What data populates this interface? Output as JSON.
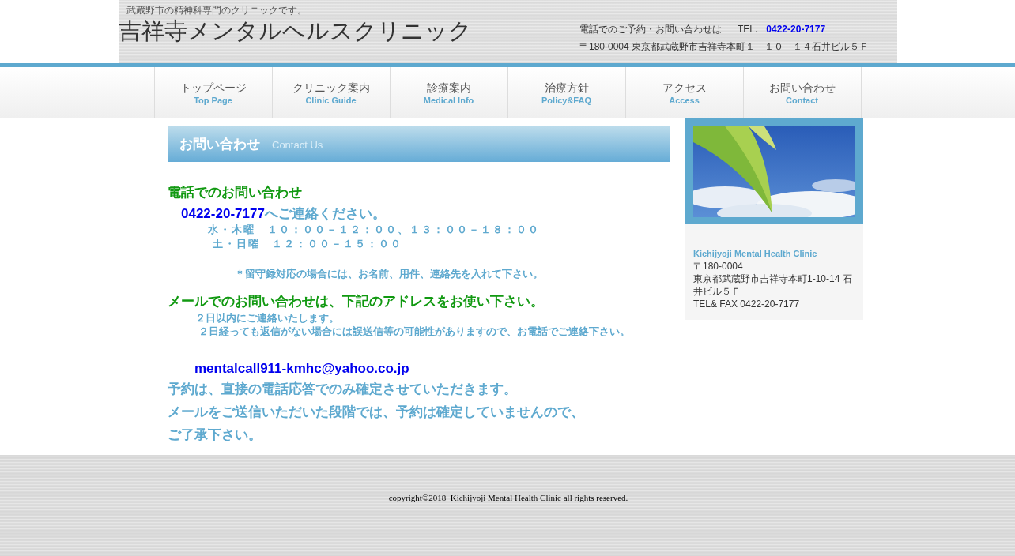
{
  "header": {
    "tagline": "武蔵野市の精神科専門のクリニックです。",
    "site_title": "吉祥寺メンタルヘルスクリニック",
    "contact_label": "電話でのご予約・お問い合わせは",
    "tel_label": "TEL.",
    "tel": "0422-20-7177",
    "address": "〒180-0004 東京都武蔵野市吉祥寺本町１－１０－１４石井ビル５Ｆ"
  },
  "nav": [
    {
      "label": "トップページ",
      "sub": "Top Page"
    },
    {
      "label": "クリニック案内",
      "sub": "Clinic Guide"
    },
    {
      "label": "診療案内",
      "sub": "Medical Info"
    },
    {
      "label": "治療方針",
      "sub": "Policy&FAQ"
    },
    {
      "label": "アクセス",
      "sub": "Access"
    },
    {
      "label": "お問い合わせ",
      "sub": "Contact"
    }
  ],
  "page_heading": {
    "title": "お問い合わせ",
    "subtitle": "Contact Us"
  },
  "content": [
    {
      "kind": "heading",
      "text": "電話でのお問い合わせ"
    },
    {
      "kind": "phone",
      "number": "0422-20-7177",
      "text": "へご連絡ください。"
    },
    {
      "kind": "hours",
      "text": "水・木曜　１０：００－１２：００、１３：００－１８：００"
    },
    {
      "kind": "hours",
      "text": " 土・日曜　１２：００－１５：００"
    },
    {
      "kind": "note",
      "text": "＊留守録対応の場合には、お名前、用件、連絡先を入れて下さい。"
    },
    {
      "kind": "heading",
      "text": "メールでのお問い合わせは、下記のアドレスをお使い下さい。"
    },
    {
      "kind": "small",
      "text": "２日以内にご連絡いたします。"
    },
    {
      "kind": "small",
      "text": " ２日経っても返信がない場合には誤送信等の可能性がありますので、お電話でご連絡下さい。"
    },
    {
      "kind": "email",
      "text": "mentalcall911-kmhc@yahoo.co.jp"
    },
    {
      "kind": "large",
      "text": "予約は、直接の電話応答でのみ確定させていただきます。"
    },
    {
      "kind": "large",
      "text": "メールをご送信いただいた段階では、予約は確定していませんので、"
    },
    {
      "kind": "large",
      "text": "ご了承下さい。"
    }
  ],
  "sidebar": {
    "clinic_name": "Kichijyoji Mental Health Clinic",
    "lines": [
      "〒180-0004",
      "東京都武蔵野市吉祥寺本町1-10-14 石井ビル５Ｆ",
      "TEL& FAX 0422-20-7177"
    ]
  },
  "footer": {
    "copyright": "copyright©2018  Kichijyoji Mental Health Clinic all rights reserved."
  }
}
